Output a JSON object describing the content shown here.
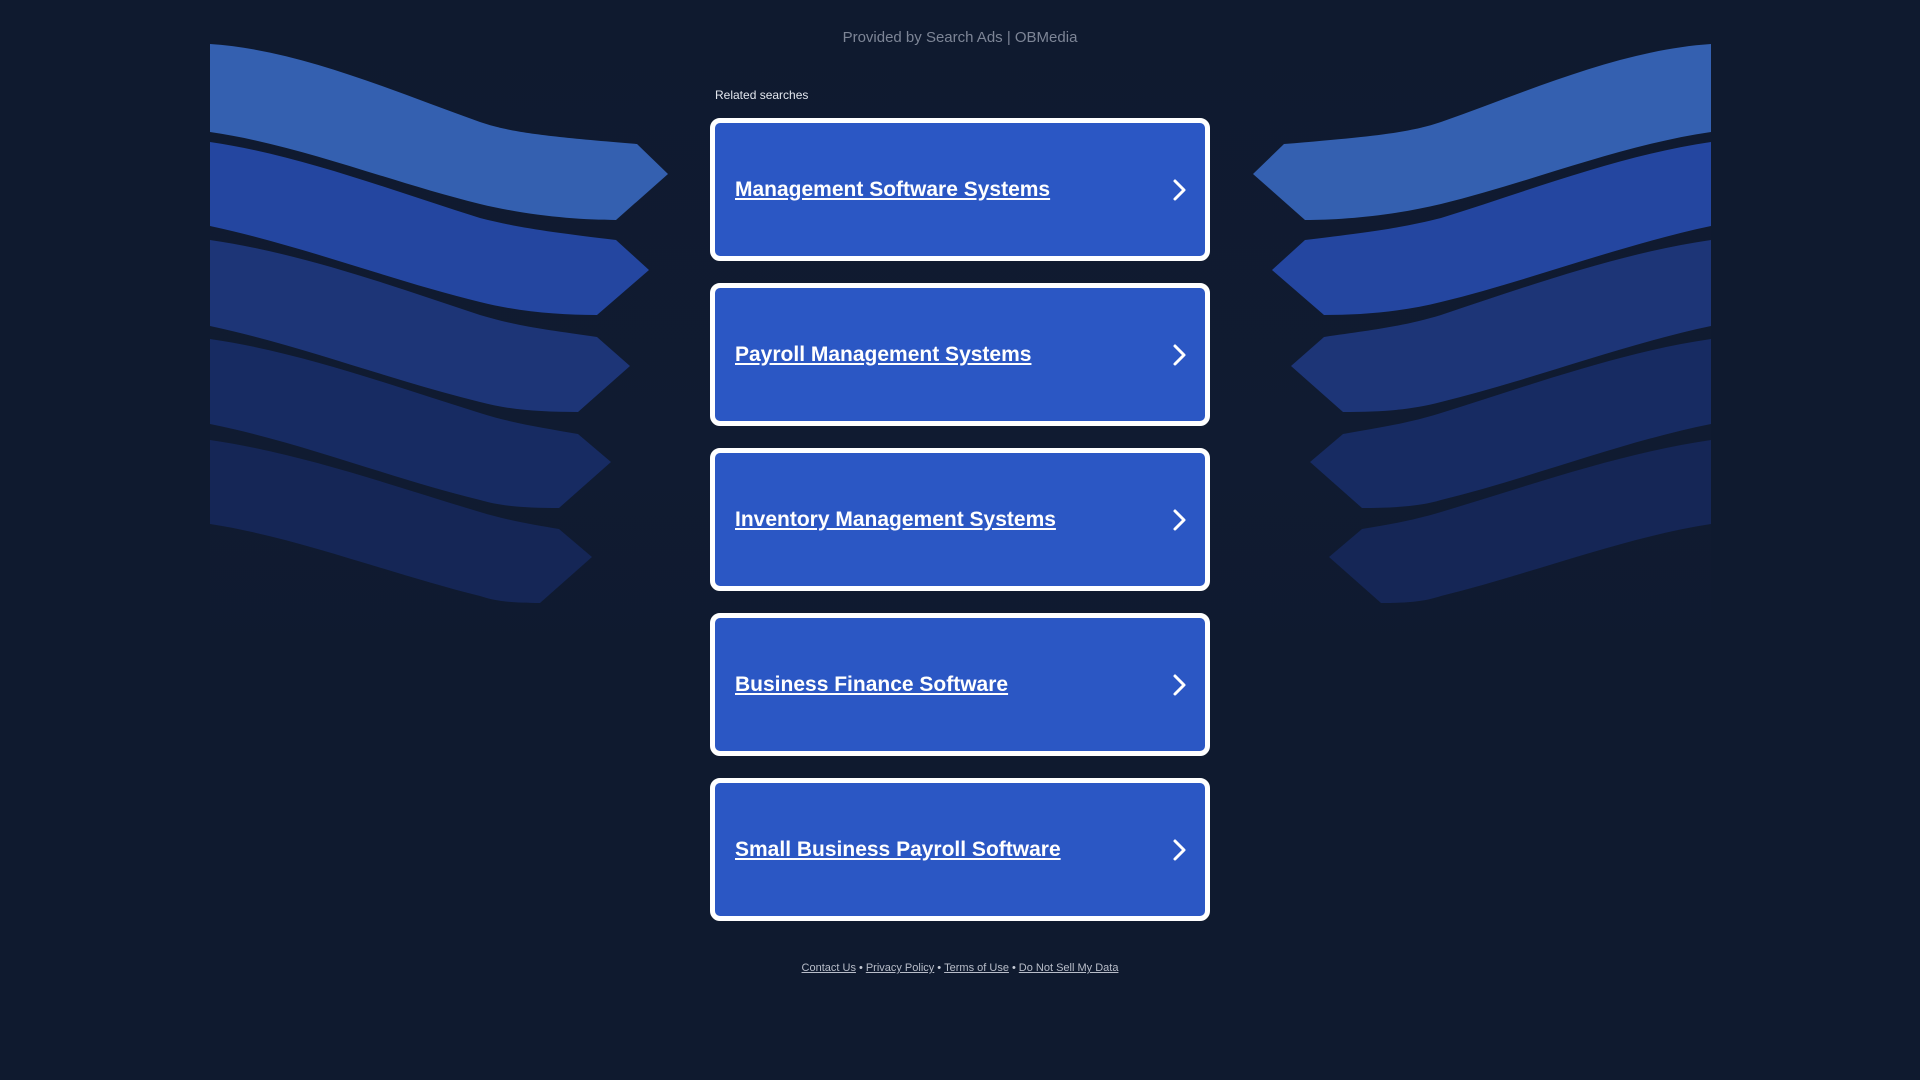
{
  "header": {
    "provider_text": "Provided by Search Ads | OBMedia"
  },
  "related": {
    "label": "Related searches",
    "items": [
      {
        "label": "Management Software Systems"
      },
      {
        "label": "Payroll Management Systems"
      },
      {
        "label": "Inventory Management Systems"
      },
      {
        "label": "Business Finance Software"
      },
      {
        "label": "Small Business Payroll Software"
      }
    ]
  },
  "footer": {
    "links": [
      {
        "label": "Contact Us"
      },
      {
        "label": "Privacy Policy"
      },
      {
        "label": "Terms of Use"
      },
      {
        "label": "Do Not Sell My Data"
      }
    ],
    "separator": "•"
  },
  "colors": {
    "background": "#0f1a2f",
    "card_fill": "#2b57c4",
    "card_border": "#ffffff",
    "wave_colors": [
      "#3460b0",
      "#2446a0",
      "#1d3577",
      "#172b62",
      "#152656",
      "#142352"
    ]
  },
  "icons": {
    "card_chevron": "chevron-right-icon"
  }
}
